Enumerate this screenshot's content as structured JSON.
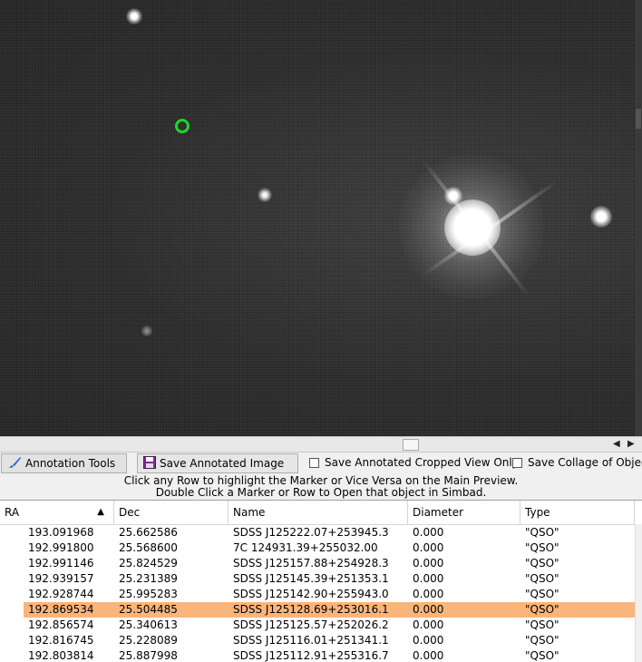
{
  "toolbar": {
    "annotation_tools": "Annotation Tools",
    "save_annotated_image": "Save Annotated Image",
    "save_cropped_label": "Save Annotated Cropped View Only",
    "save_collage_label": "Save Collage of Objec"
  },
  "hints": {
    "line1": "Click any Row to highlight the Marker or Vice Versa on the Main Preview.",
    "line2": "Double Click a Marker or Row to Open that object in Simbad."
  },
  "table": {
    "columns": [
      "RA",
      "Dec",
      "Name",
      "Diameter",
      "Type"
    ],
    "sort_column": "RA",
    "rows": [
      {
        "ra": "193.091968",
        "dec": "25.662586",
        "name": "SDSS J125222.07+253945.3",
        "diameter": "0.000",
        "type": "\"QSO\""
      },
      {
        "ra": "192.991800",
        "dec": "25.568600",
        "name": "7C 124931.39+255032.00",
        "diameter": "0.000",
        "type": "\"QSO\""
      },
      {
        "ra": "192.991146",
        "dec": "25.824529",
        "name": "SDSS J125157.88+254928.3",
        "diameter": "0.000",
        "type": "\"QSO\""
      },
      {
        "ra": "192.939157",
        "dec": "25.231389",
        "name": "SDSS J125145.39+251353.1",
        "diameter": "0.000",
        "type": "\"QSO\""
      },
      {
        "ra": "192.928744",
        "dec": "25.995283",
        "name": "SDSS J125142.90+255943.0",
        "diameter": "0.000",
        "type": "\"QSO\""
      },
      {
        "ra": "192.869534",
        "dec": "25.504485",
        "name": "SDSS J125128.69+253016.1",
        "diameter": "0.000",
        "type": "\"QSO\""
      },
      {
        "ra": "192.856574",
        "dec": "25.340613",
        "name": "SDSS J125125.57+252026.2",
        "diameter": "0.000",
        "type": "\"QSO\""
      },
      {
        "ra": "192.816745",
        "dec": "25.228089",
        "name": "SDSS J125116.01+251341.1",
        "diameter": "0.000",
        "type": "\"QSO\""
      },
      {
        "ra": "192.803814",
        "dec": "25.887998",
        "name": "SDSS J125112.91+255316.7",
        "diameter": "0.000",
        "type": "\"QSO\""
      }
    ],
    "selected_row": 5
  },
  "colors": {
    "selected_row": "#fab57a",
    "marker": "#22d32a"
  },
  "icons": {
    "annotation_tools": "brush-icon",
    "save_annotated_image": "floppy-disk-icon",
    "sort": "sort-ascending-icon"
  }
}
